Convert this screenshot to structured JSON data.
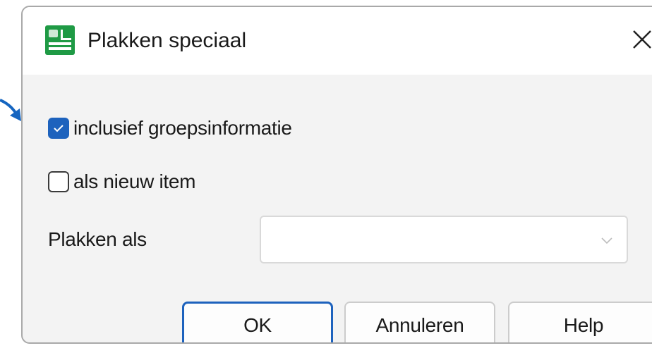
{
  "dialog": {
    "title": "Plakken speciaal",
    "app_icon": "paste-special-app-icon",
    "close_icon": "close-icon"
  },
  "options": {
    "include_group_info": {
      "label": "inclusief groepsinformatie",
      "checked": true
    },
    "as_new_item": {
      "label": "als nieuw item",
      "checked": false
    }
  },
  "paste_as": {
    "label": "Plakken als",
    "value": ""
  },
  "buttons": {
    "ok": "OK",
    "cancel": "Annuleren",
    "help": "Help"
  },
  "colors": {
    "accent": "#1d62bd",
    "app_icon": "#1f9a45",
    "arrow": "#1565c0"
  }
}
